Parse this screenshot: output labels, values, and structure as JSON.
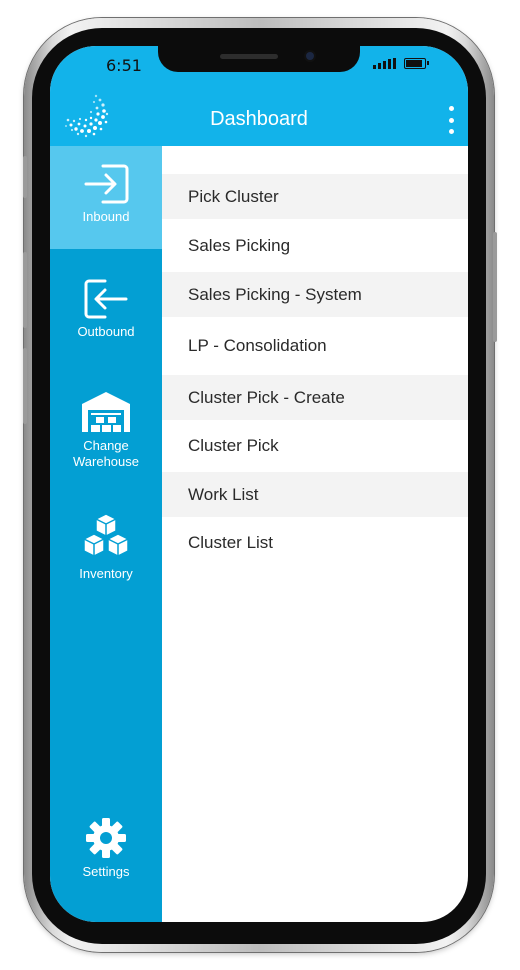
{
  "status_bar": {
    "time": "6:51"
  },
  "header": {
    "title": "Dashboard"
  },
  "sidebar": {
    "items": [
      {
        "label": "Inbound",
        "icon": "sign-in-icon"
      },
      {
        "label": "Outbound",
        "icon": "sign-out-icon"
      },
      {
        "label": "Change Warehouse",
        "icon": "warehouse-icon"
      },
      {
        "label": "Inventory",
        "icon": "boxes-icon"
      },
      {
        "label": "Settings",
        "icon": "gear-icon"
      }
    ]
  },
  "menu": {
    "items": [
      "Pick Cluster",
      "Sales Picking",
      "Sales Picking - System",
      "LP - Consolidation",
      "Cluster Pick - Create",
      "Cluster Pick",
      "Work List",
      "Cluster List"
    ]
  },
  "colors": {
    "header": "#12b3ea",
    "sidebar": "#039fd3",
    "sidebar_active": "#56c8ee",
    "row_alt": "#f3f3f3"
  }
}
